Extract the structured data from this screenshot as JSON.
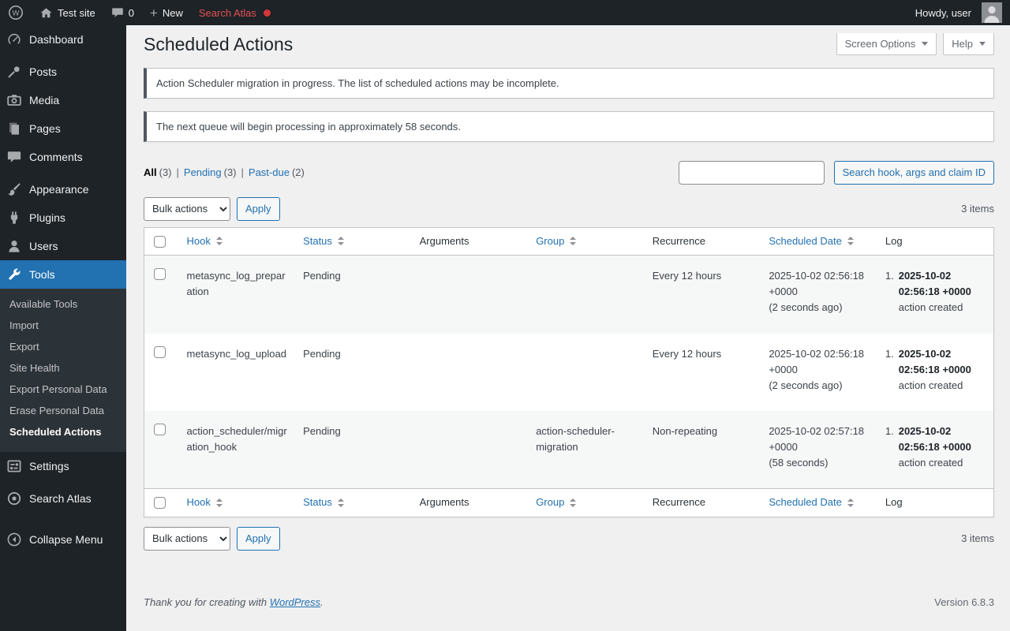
{
  "colors": {
    "accent_blue": "#2271b1",
    "admin_bar_bg": "#1d2327",
    "content_bg": "#f0f0f1",
    "search_atlas_red": "#e65054",
    "notification_dot_red": "#d63638",
    "notice_border": "#50575e"
  },
  "admin_bar": {
    "site_name": "Test site",
    "comments_count": "0",
    "new_label": "New",
    "search_atlas_label": "Search Atlas",
    "howdy": "Howdy, user"
  },
  "sidebar": {
    "items": [
      {
        "label": "Dashboard"
      },
      {
        "label": "Posts"
      },
      {
        "label": "Media"
      },
      {
        "label": "Pages"
      },
      {
        "label": "Comments"
      },
      {
        "label": "Appearance"
      },
      {
        "label": "Plugins"
      },
      {
        "label": "Users"
      },
      {
        "label": "Tools"
      },
      {
        "label": "Settings"
      },
      {
        "label": "Search Atlas"
      },
      {
        "label": "Collapse Menu"
      }
    ],
    "tools_submenu": [
      "Available Tools",
      "Import",
      "Export",
      "Site Health",
      "Export Personal Data",
      "Erase Personal Data",
      "Scheduled Actions"
    ]
  },
  "header": {
    "page_title": "Scheduled Actions",
    "screen_options_label": "Screen Options",
    "help_label": "Help"
  },
  "notices": [
    "Action Scheduler migration in progress. The list of scheduled actions may be incomplete.",
    "The next queue will begin processing in approximately 58 seconds."
  ],
  "filters": {
    "all_label": "All",
    "all_count": "(3)",
    "separator": "|",
    "pending_label": "Pending",
    "pending_count": "(3)",
    "pastdue_label": "Past-due",
    "pastdue_count": "(2)"
  },
  "search": {
    "input_value": "",
    "button_label": "Search hook, args and claim ID"
  },
  "bulk_actions": {
    "select_label": "Bulk actions",
    "apply_label": "Apply",
    "items_count": "3 items"
  },
  "table": {
    "columns": {
      "hook": "Hook",
      "status": "Status",
      "arguments": "Arguments",
      "group": "Group",
      "recurrence": "Recurrence",
      "scheduled_date": "Scheduled Date",
      "log": "Log"
    },
    "rows": [
      {
        "hook": "metasync_log_preparation",
        "status": "Pending",
        "arguments": "",
        "group": "",
        "recurrence": "Every 12 hours",
        "scheduled_date": "2025-10-02 02:56:18 +0000",
        "scheduled_date_relative": "(2 seconds ago)",
        "log_index": "1.",
        "log_date": "2025-10-02 02:56:18 +0000",
        "log_text": "action created"
      },
      {
        "hook": "metasync_log_upload",
        "status": "Pending",
        "arguments": "",
        "group": "",
        "recurrence": "Every 12 hours",
        "scheduled_date": "2025-10-02 02:56:18 +0000",
        "scheduled_date_relative": "(2 seconds ago)",
        "log_index": "1.",
        "log_date": "2025-10-02 02:56:18 +0000",
        "log_text": "action created"
      },
      {
        "hook": "action_scheduler/migration_hook",
        "status": "Pending",
        "arguments": "",
        "group": "action-scheduler-migration",
        "recurrence": "Non-repeating",
        "scheduled_date": "2025-10-02 02:57:18 +0000",
        "scheduled_date_relative": "(58 seconds)",
        "log_index": "1.",
        "log_date": "2025-10-02 02:56:18 +0000",
        "log_text": "action created"
      }
    ]
  },
  "footer": {
    "thankyou_text": "Thank you for creating with",
    "wordpress_link_label": "WordPress",
    "suffix": ".",
    "version": "Version 6.8.3"
  }
}
